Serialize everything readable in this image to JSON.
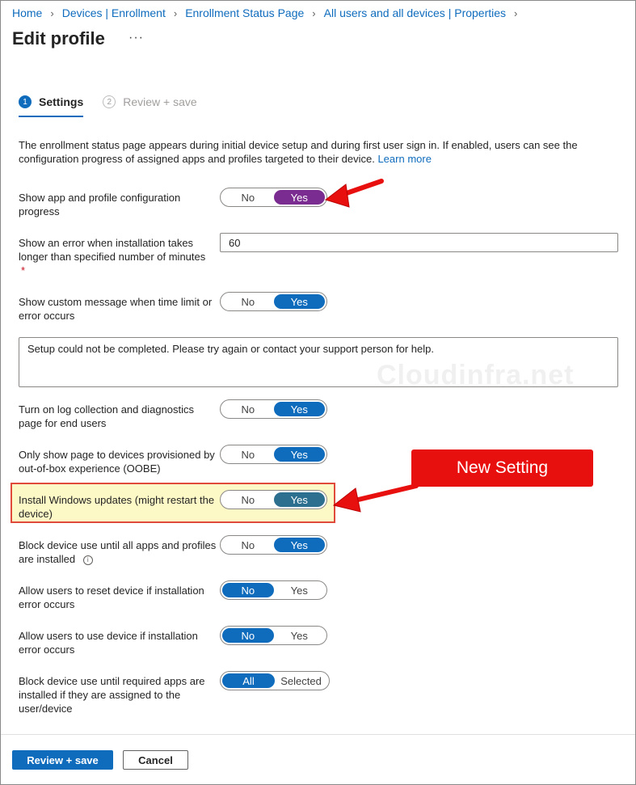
{
  "breadcrumb": [
    "Home",
    "Devices | Enrollment",
    "Enrollment Status Page",
    "All users and all devices | Properties"
  ],
  "page": {
    "title": "Edit profile",
    "more": "···"
  },
  "steps": [
    {
      "num": "1",
      "label": "Settings"
    },
    {
      "num": "2",
      "label": "Review + save"
    }
  ],
  "intro": {
    "text": "The enrollment status page appears during initial device setup and during first user sign in. If enabled, users can see the configuration progress of assigned apps and profiles targeted to their device.",
    "link": "Learn more"
  },
  "settings": {
    "show_progress": {
      "label": "Show app and profile configuration progress",
      "no": "No",
      "yes": "Yes",
      "selected": "Yes"
    },
    "error_minutes": {
      "label": "Show an error when installation takes longer than specified number of minutes",
      "required": "*",
      "value": "60"
    },
    "custom_message": {
      "label": "Show custom message when time limit or error occurs",
      "no": "No",
      "yes": "Yes",
      "selected": "Yes"
    },
    "message_text": "Setup could not be completed. Please try again or contact your support person for help.",
    "log_collection": {
      "label": "Turn on log collection and diagnostics page for end users",
      "no": "No",
      "yes": "Yes",
      "selected": "Yes"
    },
    "oobe_only": {
      "label": "Only show page to devices provisioned by out-of-box experience (OOBE)",
      "no": "No",
      "yes": "Yes",
      "selected": "Yes"
    },
    "windows_updates": {
      "label": "Install Windows updates (might restart the device)",
      "no": "No",
      "yes": "Yes",
      "selected": "Yes"
    },
    "block_until_installed": {
      "label": "Block device use until all apps and profiles are installed",
      "no": "No",
      "yes": "Yes",
      "selected": "Yes"
    },
    "allow_reset": {
      "label": "Allow users to reset device if installation error occurs",
      "no": "No",
      "yes": "Yes",
      "selected": "No"
    },
    "allow_use": {
      "label": "Allow users to use device if installation error occurs",
      "no": "No",
      "yes": "Yes",
      "selected": "No"
    },
    "block_required": {
      "label": "Block device use until required apps are installed if they are assigned to the user/device",
      "all": "All",
      "selected_opt": "Selected",
      "selected": "All"
    }
  },
  "annotations": {
    "callout": "New Setting",
    "watermark": "Cloudinfra.net"
  },
  "footer": {
    "primary": "Review + save",
    "secondary": "Cancel"
  },
  "colors": {
    "accent": "#0f6cbd",
    "highlight_purple": "#7b2c91",
    "callout_red": "#e8100f"
  }
}
